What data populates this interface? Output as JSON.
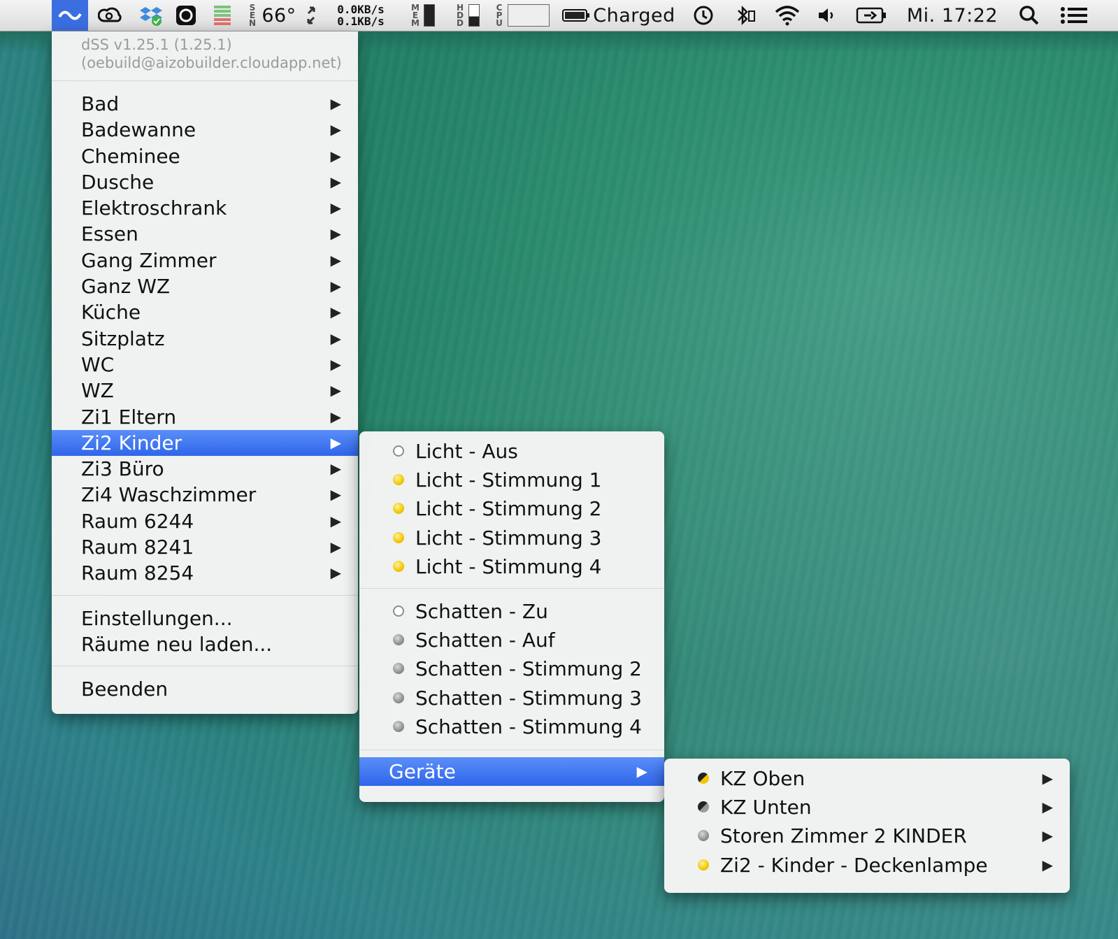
{
  "menubar": {
    "temperature": "66°",
    "temp_side_letters": "S E N",
    "net_up": "0.0KB/s",
    "net_down": "0.1KB/s",
    "mem_label": "M E M",
    "hdd_label": "H D D",
    "cpu_label": "C P U",
    "battery_status": "Charged",
    "clock": "Mi. 17:22"
  },
  "main_menu": {
    "version_line1": "dSS v1.25.1 (1.25.1)",
    "version_line2": "(oebuild@aizobuilder.cloudapp.net)",
    "rooms": [
      "Bad",
      "Badewanne",
      "Cheminee",
      "Dusche",
      "Elektroschrank",
      "Essen",
      "Gang Zimmer",
      "Ganz WZ",
      "Küche",
      "Sitzplatz",
      "WC",
      "WZ",
      "Zi1 Eltern",
      "Zi2 Kinder",
      "Zi3 Büro",
      "Zi4 Waschzimmer",
      "Raum 6244",
      "Raum 8241",
      "Raum 8254"
    ],
    "selected_room": "Zi2 Kinder",
    "settings_label": "Einstellungen...",
    "reload_label": "Räume neu laden...",
    "quit_label": "Beenden"
  },
  "scene_menu": {
    "light_items": [
      {
        "label": "Licht - Aus",
        "state": "off"
      },
      {
        "label": "Licht - Stimmung 1",
        "state": "yellow"
      },
      {
        "label": "Licht - Stimmung 2",
        "state": "yellow"
      },
      {
        "label": "Licht - Stimmung 3",
        "state": "yellow"
      },
      {
        "label": "Licht - Stimmung 4",
        "state": "yellow"
      }
    ],
    "shade_items": [
      {
        "label": "Schatten - Zu",
        "state": "off"
      },
      {
        "label": "Schatten - Auf",
        "state": "grey"
      },
      {
        "label": "Schatten - Stimmung 2",
        "state": "grey"
      },
      {
        "label": "Schatten - Stimmung 3",
        "state": "grey"
      },
      {
        "label": "Schatten - Stimmung 4",
        "state": "grey"
      }
    ],
    "devices_label": "Geräte"
  },
  "devices_menu": {
    "items": [
      {
        "label": "KZ Oben",
        "state": "half-y"
      },
      {
        "label": "KZ Unten",
        "state": "half-g"
      },
      {
        "label": "Storen Zimmer 2 KINDER",
        "state": "grey"
      },
      {
        "label": "Zi2 - Kinder - Deckenlampe",
        "state": "yellow"
      }
    ]
  },
  "colors": {
    "selection": "#3b6fe0",
    "status_yellow": "#f2c600",
    "status_grey": "#8a8a8a"
  }
}
